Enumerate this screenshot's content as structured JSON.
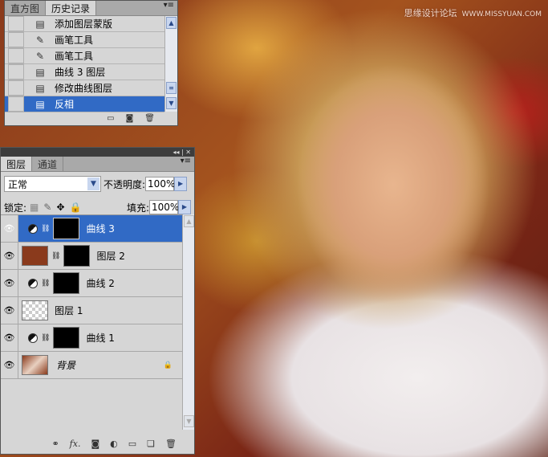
{
  "watermark": {
    "text": "思缘设计论坛",
    "url": "WWW.MISSYUAN.COM"
  },
  "history": {
    "tabs": [
      "直方图",
      "历史记录"
    ],
    "items": [
      {
        "label": "添加图层蒙版",
        "icon": "document-icon"
      },
      {
        "label": "画笔工具",
        "icon": "brush-icon"
      },
      {
        "label": "画笔工具",
        "icon": "brush-icon"
      },
      {
        "label": "曲线 3 图层",
        "icon": "document-icon"
      },
      {
        "label": "修改曲线图层",
        "icon": "document-icon"
      },
      {
        "label": "反相",
        "icon": "document-icon",
        "selected": true
      }
    ]
  },
  "layers": {
    "tabs": [
      "图层",
      "通道"
    ],
    "blend_mode": "正常",
    "opacity_label": "不透明度:",
    "opacity": "100%",
    "lock_label": "锁定:",
    "fill_label": "填充:",
    "fill": "100%",
    "items": [
      {
        "name": "曲线 3",
        "type": "adjustment",
        "selected": true
      },
      {
        "name": "图层 2",
        "type": "image-mask"
      },
      {
        "name": "曲线 2",
        "type": "adjustment"
      },
      {
        "name": "图层 1",
        "type": "transparent"
      },
      {
        "name": "曲线 1",
        "type": "adjustment"
      },
      {
        "name": "背景",
        "type": "background",
        "locked": true
      }
    ]
  },
  "colors": {
    "selection": "#316ac5",
    "panel": "#d6d6d6"
  }
}
